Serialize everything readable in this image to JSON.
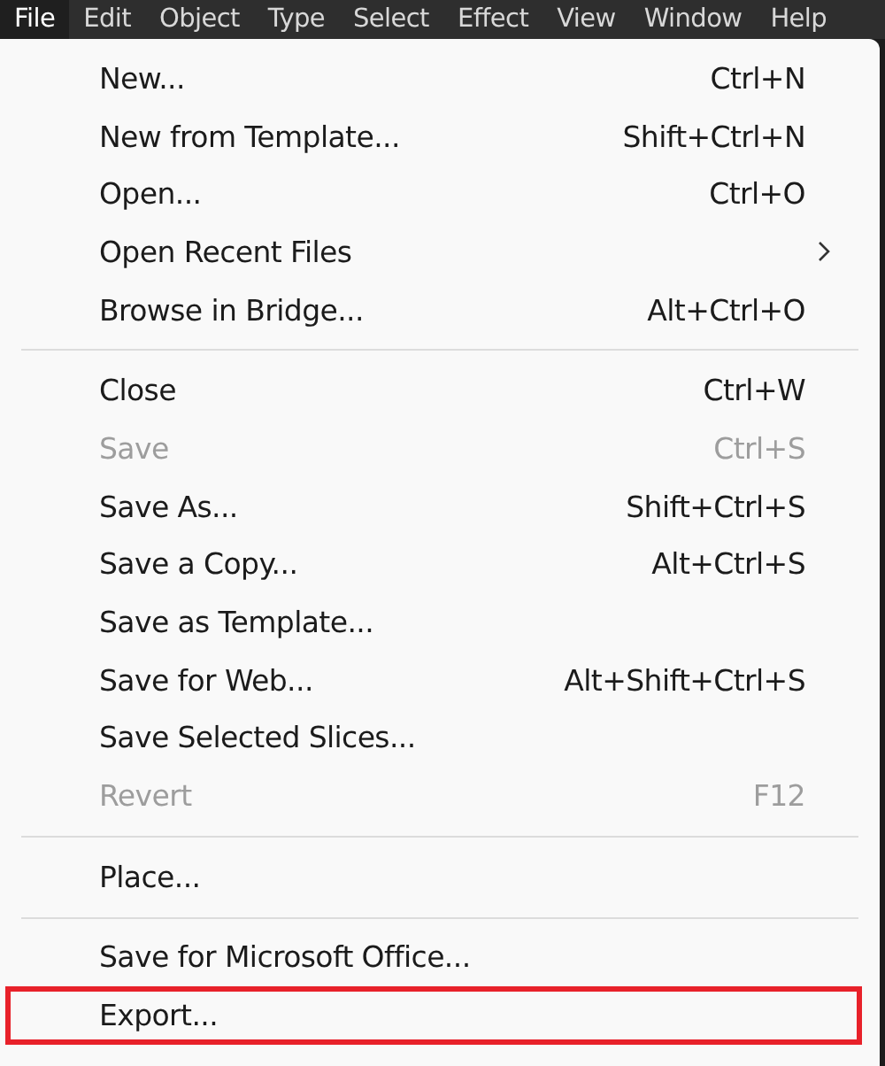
{
  "menubar": [
    {
      "label": "File",
      "selected": true
    },
    {
      "label": "Edit",
      "selected": false
    },
    {
      "label": "Object",
      "selected": false
    },
    {
      "label": "Type",
      "selected": false
    },
    {
      "label": "Select",
      "selected": false
    },
    {
      "label": "Effect",
      "selected": false
    },
    {
      "label": "View",
      "selected": false
    },
    {
      "label": "Window",
      "selected": false
    },
    {
      "label": "Help",
      "selected": false
    }
  ],
  "menu": {
    "sections": [
      {
        "items": [
          {
            "label": "New...",
            "shortcut": "Ctrl+N",
            "disabled": false
          },
          {
            "label": "New from Template...",
            "shortcut": "Shift+Ctrl+N",
            "disabled": false
          },
          {
            "label": "Open...",
            "shortcut": "Ctrl+O",
            "disabled": false
          },
          {
            "label": "Open Recent Files",
            "submenu": true,
            "disabled": false
          },
          {
            "label": "Browse in Bridge...",
            "shortcut": "Alt+Ctrl+O",
            "disabled": false
          }
        ]
      },
      {
        "items": [
          {
            "label": "Close",
            "shortcut": "Ctrl+W",
            "disabled": false
          },
          {
            "label": "Save",
            "shortcut": "Ctrl+S",
            "disabled": true
          },
          {
            "label": "Save As...",
            "shortcut": "Shift+Ctrl+S",
            "disabled": false
          },
          {
            "label": "Save a Copy...",
            "shortcut": "Alt+Ctrl+S",
            "disabled": false
          },
          {
            "label": "Save as Template...",
            "disabled": false
          },
          {
            "label": "Save for Web...",
            "shortcut": "Alt+Shift+Ctrl+S",
            "disabled": false
          },
          {
            "label": "Save Selected Slices...",
            "disabled": false
          },
          {
            "label": "Revert",
            "shortcut": "F12",
            "disabled": true
          }
        ]
      },
      {
        "items": [
          {
            "label": "Place...",
            "disabled": false
          }
        ]
      },
      {
        "items": [
          {
            "label": "Save for Microsoft Office...",
            "disabled": false
          },
          {
            "label": "Export...",
            "disabled": false,
            "highlighted": true
          }
        ]
      }
    ]
  }
}
